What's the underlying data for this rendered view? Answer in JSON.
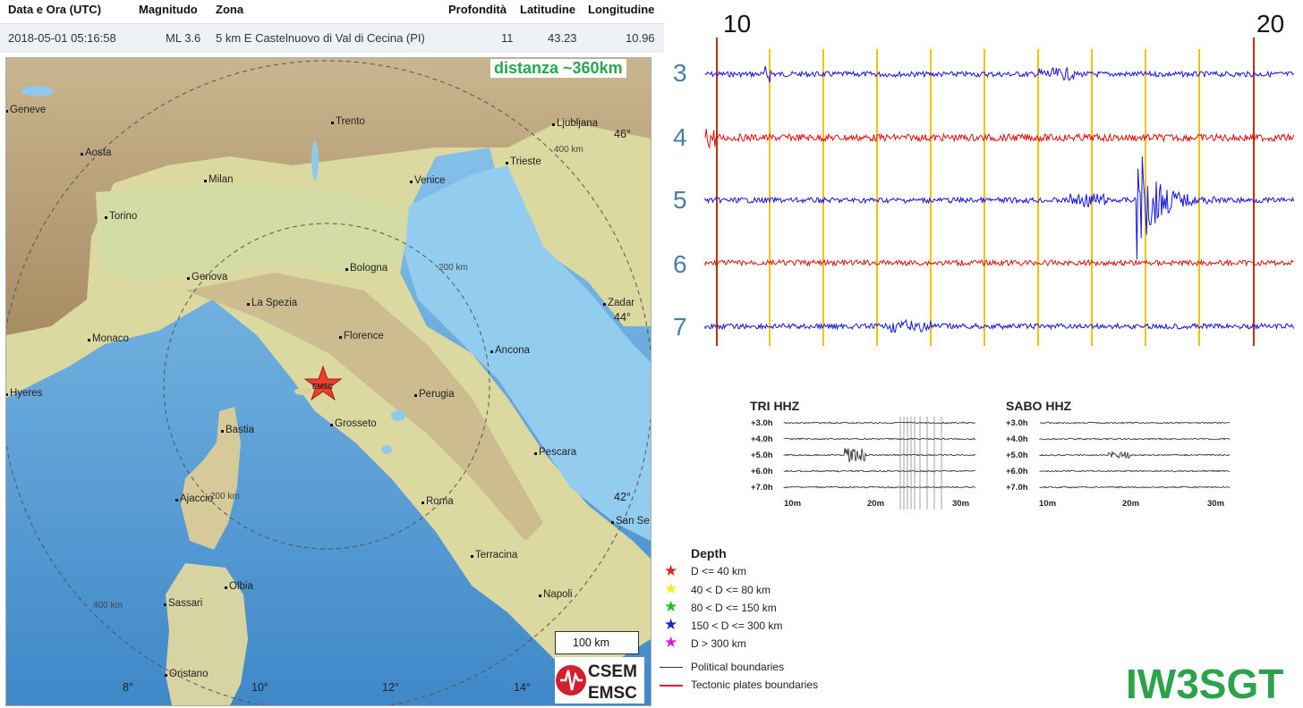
{
  "table": {
    "headers": {
      "datetime": "Data e Ora (UTC)",
      "magnitude": "Magnitudo",
      "zone": "Zona",
      "depth": "Profondità",
      "lat": "Latitudine",
      "lon": "Longitudine"
    },
    "row": {
      "datetime": "2018-05-01 05:16:58",
      "magnitude": "ML 3.6",
      "zone": "5 km E Castelnuovo di Val di Cecina (PI)",
      "depth": "11",
      "lat": "43.23",
      "lon": "10.96"
    }
  },
  "map": {
    "distance_label": "distanza ~360km",
    "epicenter_label": "EMSC",
    "cities": [
      "Geneve",
      "Aosta",
      "Trento",
      "Ljubljana",
      "Trieste",
      "Milan",
      "Venice",
      "Torino",
      "Genova",
      "Bologna",
      "La Spezia",
      "Monaco",
      "Florence",
      "Ancona",
      "Zadar",
      "Hyeres",
      "Perugia",
      "Bastia",
      "Grosseto",
      "Pescara",
      "Ajaccio",
      "Roma",
      "San Se",
      "Terracina",
      "Olbia",
      "Sassari",
      "Napoli",
      "Oristano"
    ],
    "rings": [
      "200 km",
      "400 km",
      "400 km",
      "200 km"
    ],
    "lat_ticks": [
      "46°",
      "44°",
      "42°"
    ],
    "lon_ticks": [
      "8°",
      "10°",
      "12°",
      "14°"
    ],
    "scale_label": "100 km",
    "logo_top": "CSEM",
    "logo_bottom": "EMSC"
  },
  "helicorder": {
    "minute_labels": [
      "10",
      "20"
    ],
    "rows": [
      "3",
      "4",
      "5",
      "6",
      "7"
    ],
    "colors": {
      "blue": "#1515e0",
      "red": "#e01010",
      "marker": "#f5c400",
      "dark_marker": "#c03000"
    }
  },
  "mini": {
    "tri": {
      "title": "TRI HHZ",
      "hours": [
        "+3.0h",
        "+4.0h",
        "+5.0h",
        "+6.0h",
        "+7.0h"
      ],
      "minutes": [
        "10m",
        "20m",
        "30m"
      ]
    },
    "sabo": {
      "title": "SABO HHZ",
      "hours": [
        "+3.0h",
        "+4.0h",
        "+5.0h",
        "+6.0h",
        "+7.0h"
      ],
      "minutes": [
        "10m",
        "20m",
        "30m"
      ]
    }
  },
  "legend": {
    "title": "Depth",
    "items": [
      {
        "label": "D <= 40 km",
        "color": "#e02020"
      },
      {
        "label": "40 < D <= 80 km",
        "color": "#f0f020"
      },
      {
        "label": "80 < D <= 150 km",
        "color": "#20c020"
      },
      {
        "label": "150 < D <= 300 km",
        "color": "#2020d0"
      },
      {
        "label": "D > 300 km",
        "color": "#d020d0"
      }
    ],
    "boundaries": [
      {
        "label": "Political boundaries",
        "color": "#333333"
      },
      {
        "label": "Tectonic plates boundaries",
        "color": "#e02020"
      }
    ]
  },
  "callsign": "IW3SGT"
}
